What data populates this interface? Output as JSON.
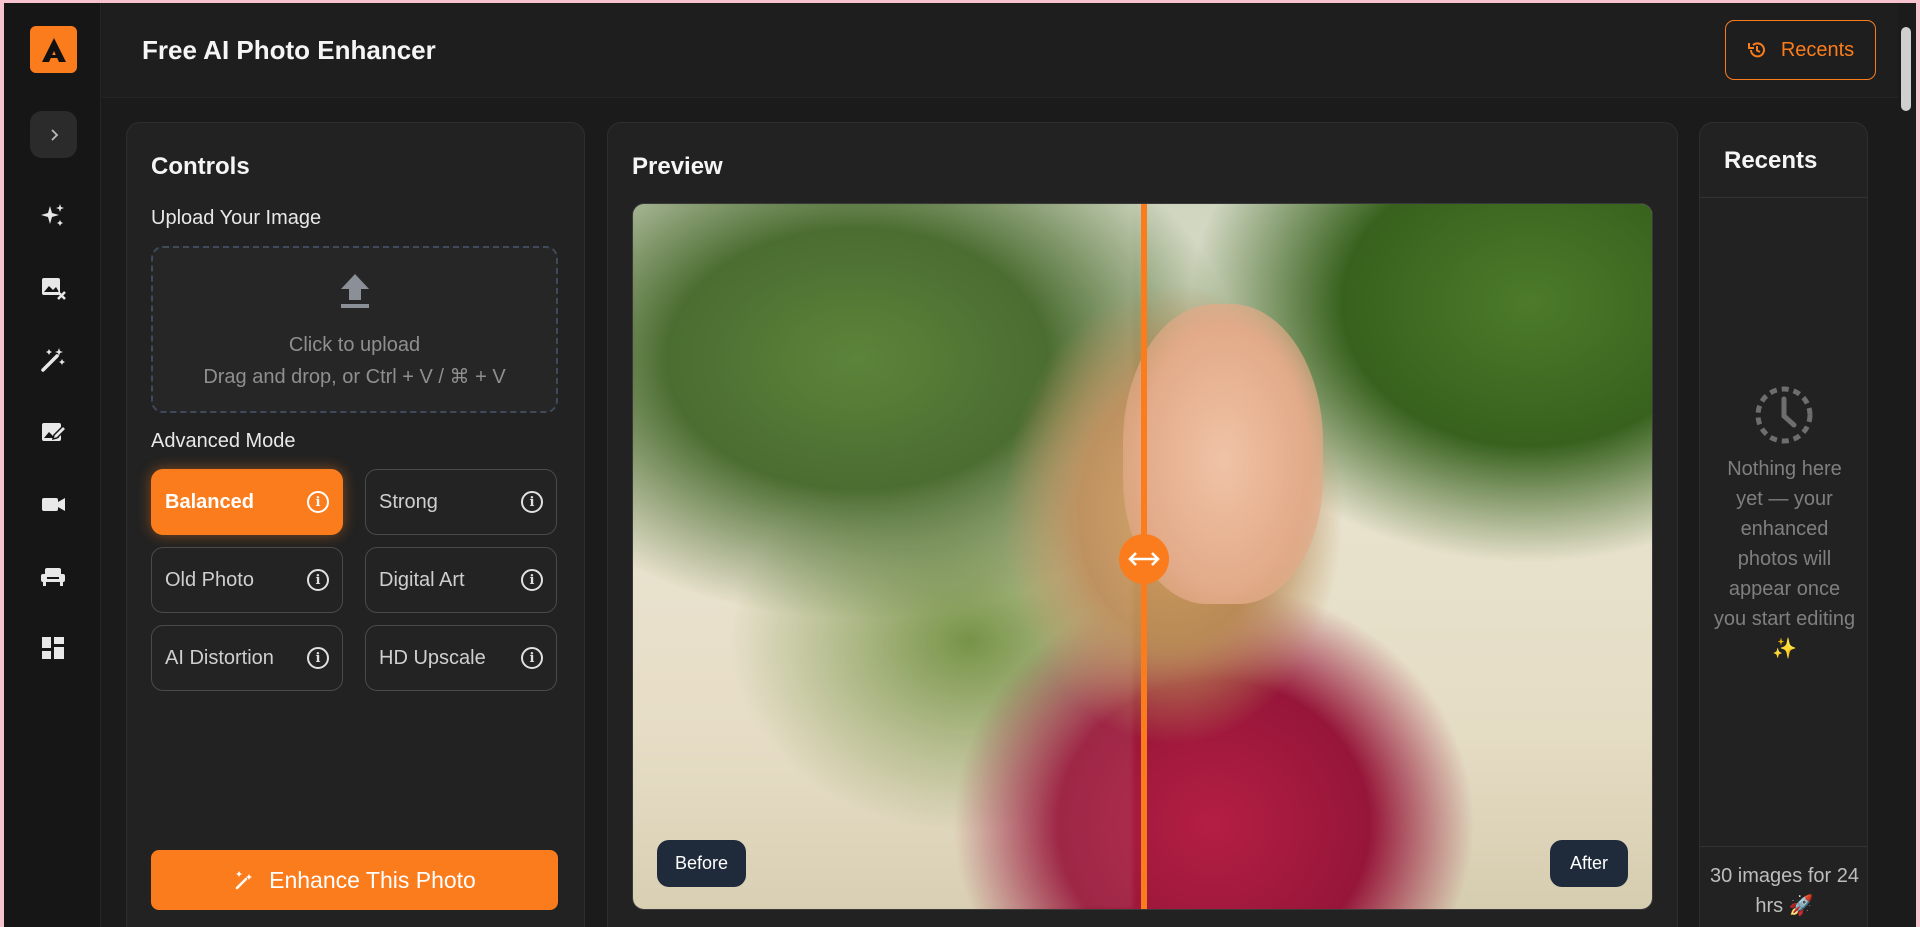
{
  "app": {
    "title": "Free AI Photo Enhancer",
    "accent_color": "#fb7c1c"
  },
  "header": {
    "recents_button": "Recents",
    "recents_icon": "history-icon"
  },
  "sidebar": {
    "logo": "A",
    "toggle_icon": "chevron-right-icon",
    "items": [
      {
        "icon": "sparkles-icon"
      },
      {
        "icon": "image-remove-icon"
      },
      {
        "icon": "magic-wand-icon"
      },
      {
        "icon": "image-edit-icon"
      },
      {
        "icon": "video-camera-icon"
      },
      {
        "icon": "sofa-icon"
      },
      {
        "icon": "grid-icon"
      }
    ]
  },
  "controls": {
    "title": "Controls",
    "upload_label": "Upload Your Image",
    "upload_line1": "Click to upload",
    "upload_line2": "Drag and drop, or Ctrl + V / ⌘ + V",
    "advanced_label": "Advanced Mode",
    "modes": [
      {
        "label": "Balanced",
        "selected": true
      },
      {
        "label": "Strong",
        "selected": false
      },
      {
        "label": "Old Photo",
        "selected": false
      },
      {
        "label": "Digital Art",
        "selected": false
      },
      {
        "label": "AI Distortion",
        "selected": false
      },
      {
        "label": "HD Upscale",
        "selected": false
      }
    ],
    "enhance_button": "Enhance This Photo"
  },
  "preview": {
    "title": "Preview",
    "before_label": "Before",
    "after_label": "After",
    "slider_position": 0.5
  },
  "recents_panel": {
    "title": "Recents",
    "empty_icon": "clock-icon",
    "empty_text": "Nothing here yet — your enhanced photos will appear once you start editing ✨",
    "quota": "30 images for 24 hrs 🚀"
  }
}
